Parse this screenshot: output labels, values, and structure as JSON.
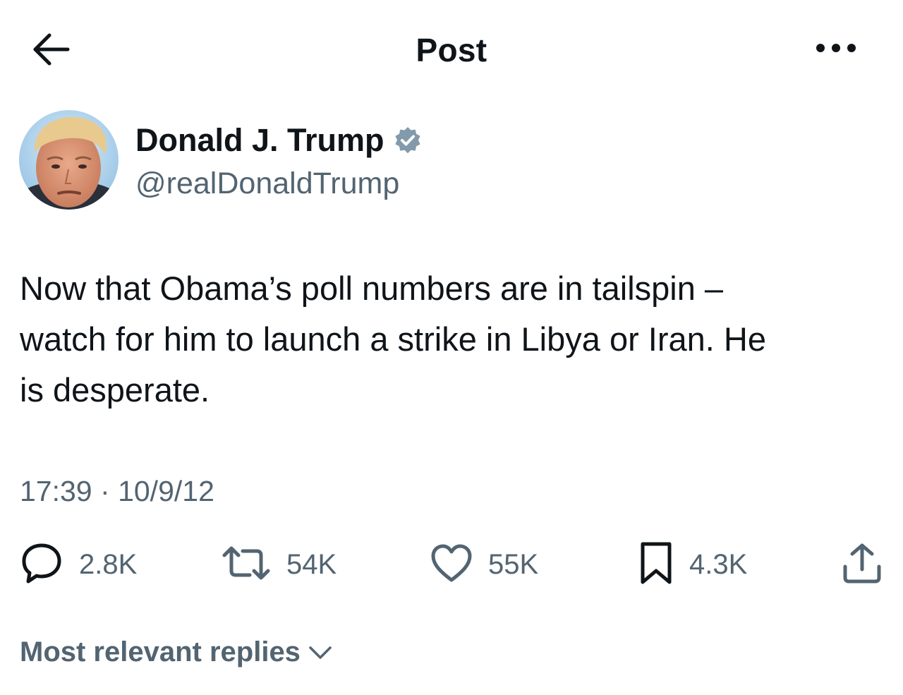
{
  "header": {
    "title": "Post"
  },
  "author": {
    "display_name": "Donald J. Trump",
    "handle": "@realDonaldTrump",
    "verified": true
  },
  "tweet": {
    "text": "Now that Obama’s poll numbers are in tailspin –\nwatch for him to launch a strike in Libya or Iran.  He\nis desperate.",
    "time": "17:39",
    "separator": "·",
    "date": "10/9/12"
  },
  "stats": {
    "replies": "2.8K",
    "reposts": "54K",
    "likes": "55K",
    "bookmarks": "4.3K"
  },
  "replies_sort": {
    "label": "Most relevant replies"
  },
  "icons": {
    "back": "arrow-left-icon",
    "more": "more-horizontal-icon",
    "verified": "verified-badge-icon",
    "reply": "reply-icon",
    "repost": "repost-icon",
    "like": "heart-icon",
    "bookmark": "bookmark-icon",
    "share": "share-icon",
    "chevron": "chevron-down-icon"
  },
  "colors": {
    "text_primary": "#0f1419",
    "text_secondary": "#536471",
    "verified_badge": "#829aab",
    "background": "#ffffff"
  }
}
